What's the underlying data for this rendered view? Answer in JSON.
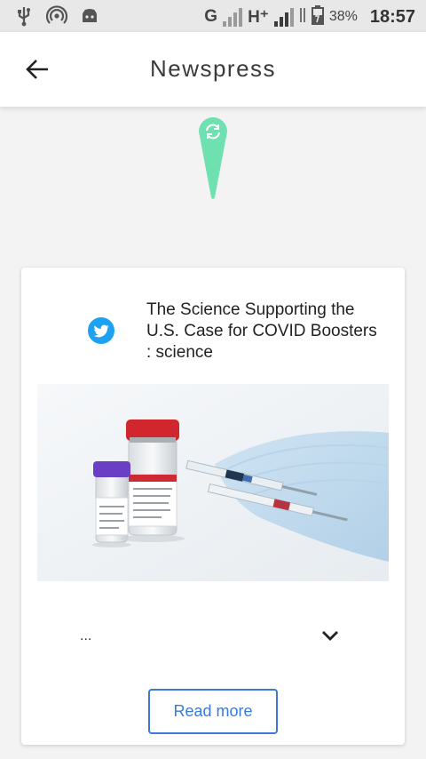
{
  "status_bar": {
    "network_type_1": "G",
    "network_type_2": "H⁺",
    "battery_percent": "38%",
    "time": "18:57",
    "icons": [
      "usb-icon",
      "hotspot-icon",
      "android-icon",
      "signal-icon",
      "battery-icon"
    ]
  },
  "app_bar": {
    "title": "Newspress",
    "back_icon": "arrow-left-icon"
  },
  "refresh": {
    "icon": "refresh-icon",
    "color": "#6fe0b0"
  },
  "article": {
    "source_icon": "twitter-icon",
    "source_color": "#1da1f2",
    "title": "The Science Supporting the U.S. Case for COVID Boosters : science",
    "image_alt": "vaccine-vials-and-syringes-image",
    "excerpt": "...",
    "expand_icon": "chevron-down-icon",
    "read_more_label": "Read more",
    "accent": "#3a7bd5"
  }
}
